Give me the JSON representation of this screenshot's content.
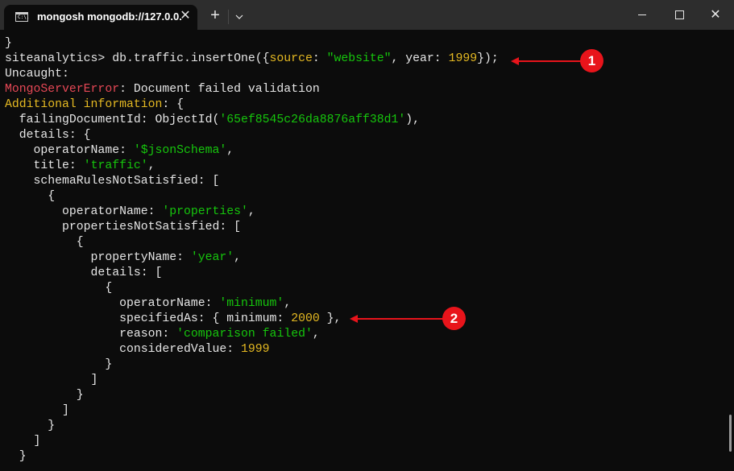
{
  "window": {
    "tab_title": "mongosh mongodb://127.0.0.",
    "tab_icon": "terminal-icon",
    "tab_icon_text": "C:\\.",
    "close_tab_glyph": "✕",
    "new_tab_glyph": "+",
    "dropdown_glyph": "⌄",
    "close_window_glyph": "✕"
  },
  "terminal": {
    "lines": [
      [
        {
          "t": "}",
          "c": "c-white"
        }
      ],
      [
        {
          "t": "siteanalytics> db.traffic.insertOne({",
          "c": "c-white"
        },
        {
          "t": "source",
          "c": "c-yellow"
        },
        {
          "t": ": ",
          "c": "c-white"
        },
        {
          "t": "\"website\"",
          "c": "c-green"
        },
        {
          "t": ", year: ",
          "c": "c-white"
        },
        {
          "t": "1999",
          "c": "c-yellow"
        },
        {
          "t": "});",
          "c": "c-white"
        }
      ],
      [
        {
          "t": "Uncaught:",
          "c": "c-white"
        }
      ],
      [
        {
          "t": "MongoServerError",
          "c": "c-red"
        },
        {
          "t": ": Document failed validation",
          "c": "c-white"
        }
      ],
      [
        {
          "t": "Additional information",
          "c": "c-yellow"
        },
        {
          "t": ": {",
          "c": "c-white"
        }
      ],
      [
        {
          "t": "  failingDocumentId: ObjectId(",
          "c": "c-white"
        },
        {
          "t": "'65ef8545c26da8876aff38d1'",
          "c": "c-green"
        },
        {
          "t": "),",
          "c": "c-white"
        }
      ],
      [
        {
          "t": "  details: {",
          "c": "c-white"
        }
      ],
      [
        {
          "t": "    operatorName: ",
          "c": "c-white"
        },
        {
          "t": "'$jsonSchema'",
          "c": "c-green"
        },
        {
          "t": ",",
          "c": "c-white"
        }
      ],
      [
        {
          "t": "    title: ",
          "c": "c-white"
        },
        {
          "t": "'traffic'",
          "c": "c-green"
        },
        {
          "t": ",",
          "c": "c-white"
        }
      ],
      [
        {
          "t": "    schemaRulesNotSatisfied: [",
          "c": "c-white"
        }
      ],
      [
        {
          "t": "      {",
          "c": "c-white"
        }
      ],
      [
        {
          "t": "        operatorName: ",
          "c": "c-white"
        },
        {
          "t": "'properties'",
          "c": "c-green"
        },
        {
          "t": ",",
          "c": "c-white"
        }
      ],
      [
        {
          "t": "        propertiesNotSatisfied: [",
          "c": "c-white"
        }
      ],
      [
        {
          "t": "          {",
          "c": "c-white"
        }
      ],
      [
        {
          "t": "            propertyName: ",
          "c": "c-white"
        },
        {
          "t": "'year'",
          "c": "c-green"
        },
        {
          "t": ",",
          "c": "c-white"
        }
      ],
      [
        {
          "t": "            details: [",
          "c": "c-white"
        }
      ],
      [
        {
          "t": "              {",
          "c": "c-white"
        }
      ],
      [
        {
          "t": "                operatorName: ",
          "c": "c-white"
        },
        {
          "t": "'minimum'",
          "c": "c-green"
        },
        {
          "t": ",",
          "c": "c-white"
        }
      ],
      [
        {
          "t": "                specifiedAs: { minimum: ",
          "c": "c-white"
        },
        {
          "t": "2000",
          "c": "c-yellow"
        },
        {
          "t": " },",
          "c": "c-white"
        }
      ],
      [
        {
          "t": "                reason: ",
          "c": "c-white"
        },
        {
          "t": "'comparison failed'",
          "c": "c-green"
        },
        {
          "t": ",",
          "c": "c-white"
        }
      ],
      [
        {
          "t": "                consideredValue: ",
          "c": "c-white"
        },
        {
          "t": "1999",
          "c": "c-yellow"
        }
      ],
      [
        {
          "t": "              }",
          "c": "c-white"
        }
      ],
      [
        {
          "t": "            ]",
          "c": "c-white"
        }
      ],
      [
        {
          "t": "          }",
          "c": "c-white"
        }
      ],
      [
        {
          "t": "        ]",
          "c": "c-white"
        }
      ],
      [
        {
          "t": "      }",
          "c": "c-white"
        }
      ],
      [
        {
          "t": "    ]",
          "c": "c-white"
        }
      ],
      [
        {
          "t": "  }",
          "c": "c-white"
        }
      ]
    ]
  },
  "annotations": [
    {
      "label": "1"
    },
    {
      "label": "2"
    }
  ],
  "colors": {
    "background": "#0c0c0c",
    "titlebar": "#2d2d2d",
    "annotation": "#e8141b",
    "string": "#16c60c",
    "number_key": "#e5b922",
    "error": "#e74856"
  }
}
